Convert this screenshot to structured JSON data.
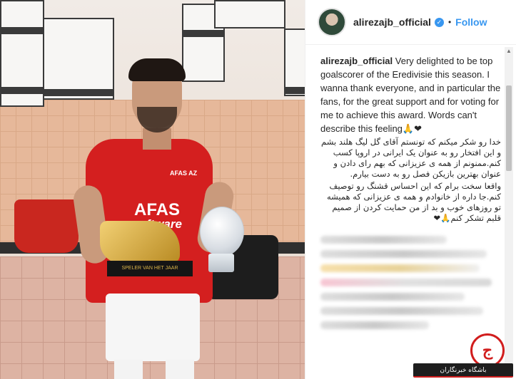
{
  "post": {
    "username": "alirezajb_official",
    "follow_label": "Follow",
    "separator": "•",
    "verified_mark": "✓"
  },
  "photo": {
    "sponsor_main": "AFAS",
    "sponsor_sub": "software",
    "chest_badge": "AFAS AZ",
    "award_plaque": "SPELER VAN HET JAAR"
  },
  "caption": {
    "english": "Very delighted to be top goalscorer of the Eredivisie this season. I wanna thank everyone, and in particular the fans, for the great support and for voting for me to achieve this award. Words can't describe this feeling🙏❤",
    "persian_1": "خدا رو شکر میکنم که تونستم آقای گل لیگ هلند بشم و این افتخار رو به عنوان یک ایرانی در اروپا کسب کنم.ممنونم از همه ی عزیزانی که بهم رای دادن و عنوان بهترین بازیکن فصل رو به دست بیارم.",
    "persian_2": "واقعا سخت برام که این احساس قشنگ رو توصیف کنم.جا داره از خانوادم و همه ی عزیزانی که همیشه تو روزهای خوب و بد از من حمایت کردن از صمیم قلبم تشکر کنم🙏❤"
  },
  "watermark": {
    "brand": "باشگاه خبرنگاران",
    "symbol": "ج"
  },
  "colors": {
    "follow": "#3897f0",
    "jersey": "#d41f1f"
  },
  "icons": [
    "verified-badge-icon",
    "scroll-up-arrow",
    "scroll-down-arrow"
  ]
}
